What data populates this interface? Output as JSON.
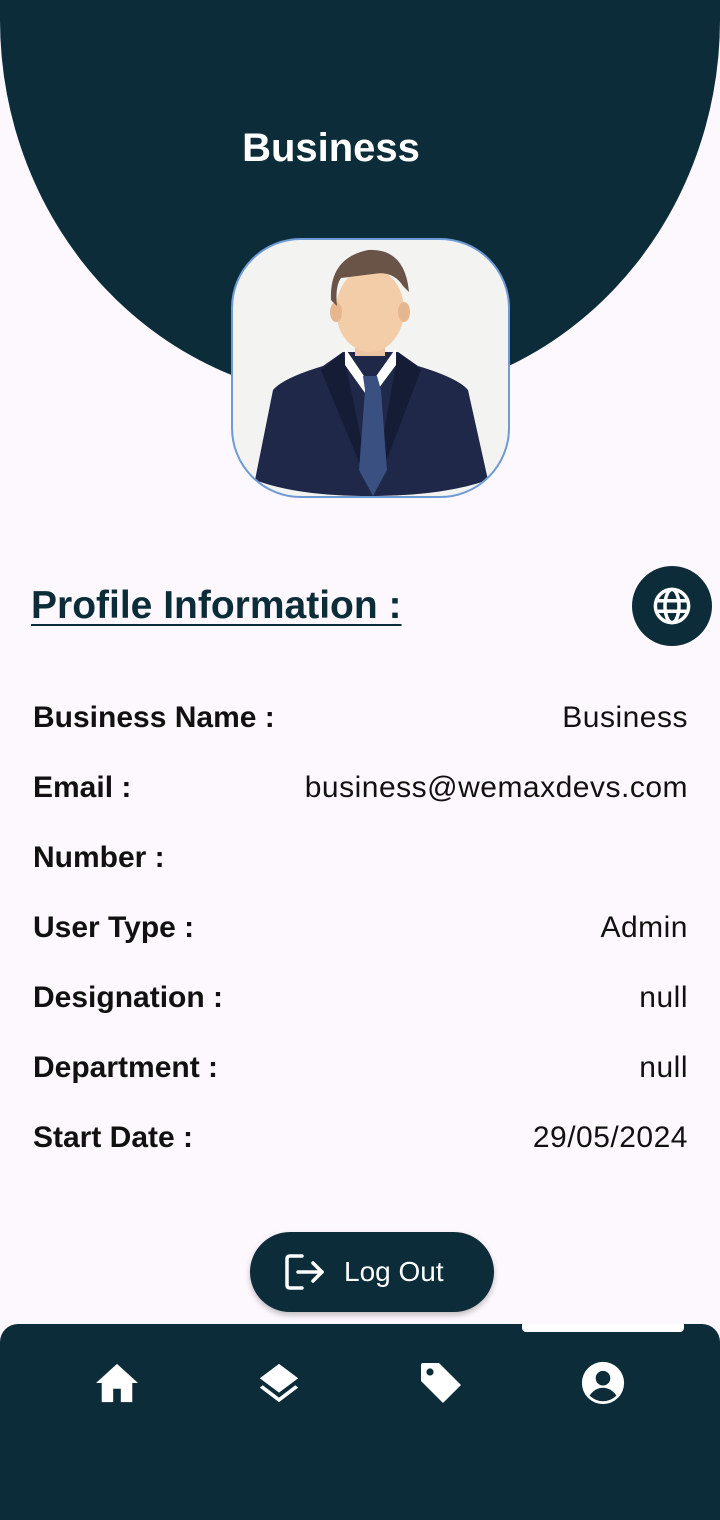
{
  "header": {
    "title": "Business"
  },
  "profile": {
    "section_title": "Profile Information :",
    "fields": [
      {
        "label": "Business Name :",
        "value": "Business"
      },
      {
        "label": "Email :",
        "value": "business@wemaxdevs.com"
      },
      {
        "label": "Number :",
        "value": ""
      },
      {
        "label": "User Type :",
        "value": "Admin"
      },
      {
        "label": "Designation :",
        "value": "null"
      },
      {
        "label": "Department :",
        "value": "null"
      },
      {
        "label": "Start Date :",
        "value": "29/05/2024"
      }
    ]
  },
  "actions": {
    "logout_label": "Log Out"
  },
  "nav": {
    "items": [
      {
        "icon": "home-icon"
      },
      {
        "icon": "layers-icon"
      },
      {
        "icon": "tag-icon"
      },
      {
        "icon": "account-circle-icon",
        "active": true
      }
    ]
  },
  "colors": {
    "primary": "#0b2c38",
    "background": "#fdf8fd",
    "avatar_border": "#6f9ad6"
  }
}
